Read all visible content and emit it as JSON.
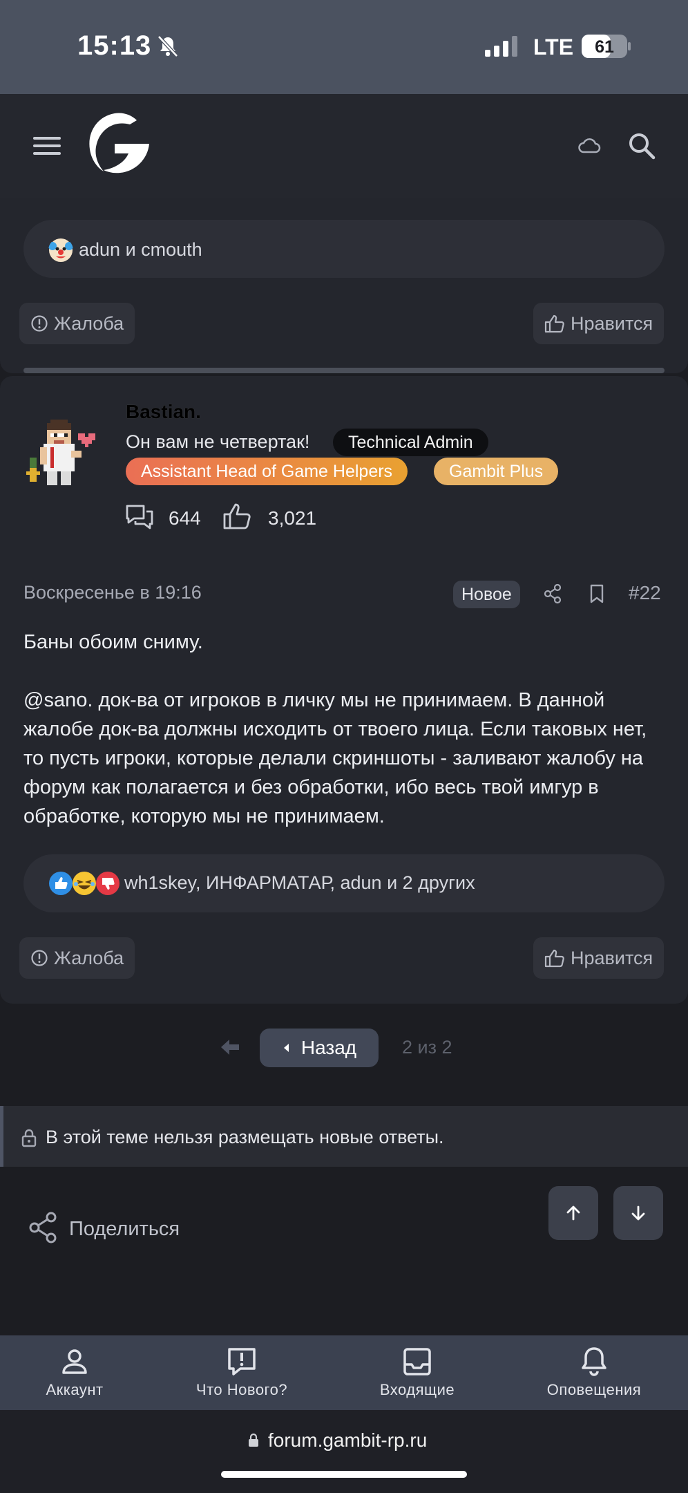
{
  "status_bar": {
    "time": "15:13",
    "network": "LTE",
    "battery": "61"
  },
  "prev_post": {
    "reactions_text": "adun и cmouth",
    "report_label": "Жалоба",
    "like_label": "Нравится"
  },
  "post": {
    "author": "Bastian.",
    "user_title": "Он вам не четвертак!",
    "badges": [
      "Technical Admin",
      "Assistant Head of Game Helpers",
      "Gambit Plus"
    ],
    "messages_count": "644",
    "likes_count": "3,021",
    "date": "Воскресенье в 19:16",
    "new_label": "Новое",
    "number": "#22",
    "body": [
      "Баны обоим сниму.",
      "@sano. док-ва от игроков в личку мы не принимаем. В данной жалобе док-ва должны исходить от твоего лица. Если таковых нет, то пусть игроки, которые делали скриншоты - заливают жалобу на форум как полагается и без обработки, ибо весь твой имгур в обработке, которую мы не принимаем."
    ],
    "reactions_text": "wh1skey, ИНФАРМАТАР, adun и 2 других",
    "report_label": "Жалоба",
    "like_label": "Нравится"
  },
  "pagination": {
    "back_label": "Назад",
    "page_info": "2 из 2"
  },
  "locked_notice": "В этой теме нельзя размещать новые ответы.",
  "share_label": "Поделиться",
  "bottom_nav": [
    {
      "label": "Аккаунт",
      "icon": "account-icon"
    },
    {
      "label": "Что Нового?",
      "icon": "whats-new-icon"
    },
    {
      "label": "Входящие",
      "icon": "inbox-icon"
    },
    {
      "label": "Оповещения",
      "icon": "bell-icon"
    }
  ],
  "url": "forum.gambit-rp.ru",
  "colors": {
    "background": "#1c1d22",
    "card": "#24262d",
    "nav": "#3b4150",
    "badge_orange": "#ea6f55",
    "badge_gold": "#e8b266"
  }
}
